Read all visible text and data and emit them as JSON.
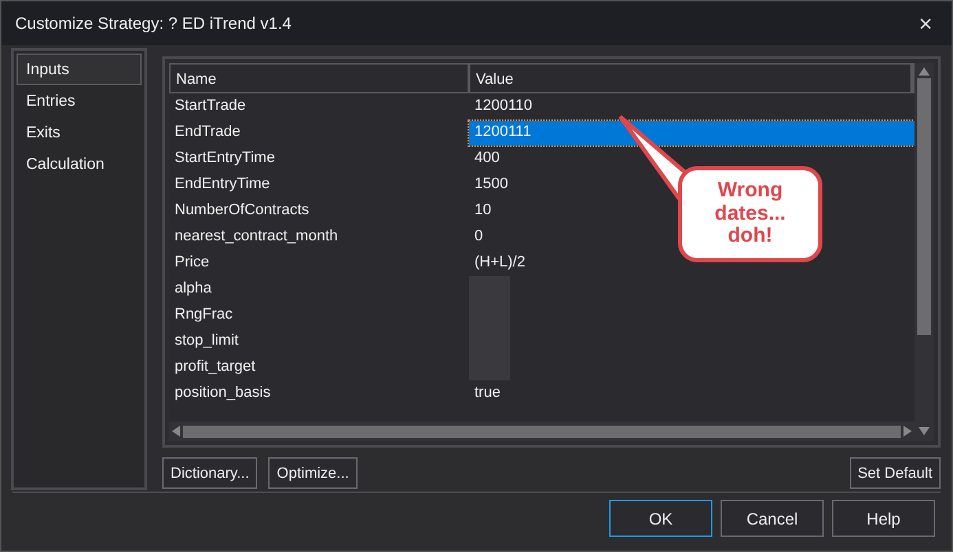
{
  "window": {
    "title": "Customize Strategy: ? ED iTrend v1.4",
    "close": "×"
  },
  "sidebar": {
    "items": [
      {
        "label": "Inputs",
        "selected": true
      },
      {
        "label": "Entries",
        "selected": false
      },
      {
        "label": "Exits",
        "selected": false
      },
      {
        "label": "Calculation",
        "selected": false
      }
    ]
  },
  "table": {
    "columns": [
      "Name",
      "Value"
    ],
    "rows": [
      {
        "name": "StartTrade",
        "value": "1200110",
        "selected": false
      },
      {
        "name": "EndTrade",
        "value": "1200111",
        "selected": true
      },
      {
        "name": "StartEntryTime",
        "value": "400",
        "selected": false
      },
      {
        "name": "EndEntryTime",
        "value": "1500",
        "selected": false
      },
      {
        "name": "NumberOfContracts",
        "value": "10",
        "selected": false
      },
      {
        "name": "nearest_contract_month",
        "value": "0",
        "selected": false
      },
      {
        "name": "Price",
        "value": "(H+L)/2",
        "selected": false
      },
      {
        "name": "alpha",
        "selected": false,
        "redacted": true
      },
      {
        "name": "RngFrac",
        "selected": false,
        "redacted": true
      },
      {
        "name": "stop_limit",
        "selected": false,
        "redacted": true
      },
      {
        "name": "profit_target",
        "selected": false,
        "redacted": true
      },
      {
        "name": "position_basis",
        "value": "true",
        "selected": false
      }
    ]
  },
  "callout": {
    "text": "Wrong dates... doh!"
  },
  "table_buttons": [
    "Dictionary...",
    "Optimize...",
    "Set Default"
  ],
  "dialog_buttons": [
    {
      "label": "OK",
      "default": true
    },
    {
      "label": "Cancel",
      "default": false
    },
    {
      "label": "Help",
      "default": false
    }
  ]
}
